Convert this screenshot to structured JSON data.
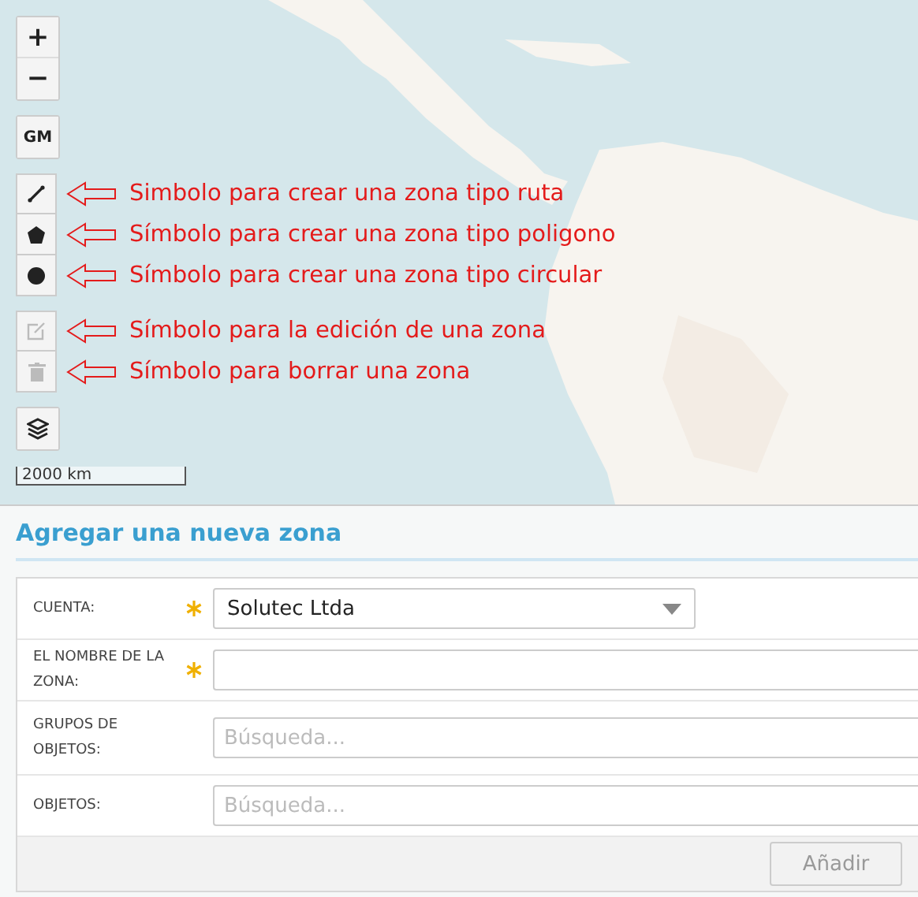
{
  "map": {
    "kind": "picture",
    "zoom_controls": [
      {
        "label": "+"
      },
      {
        "label": "−"
      }
    ],
    "gm_button": "GM",
    "draw_tools": [
      {
        "kind": "line",
        "disabled": false,
        "annotation": "Simbolo para crear una zona tipo ruta"
      },
      {
        "kind": "polygon",
        "disabled": false,
        "annotation": "Símbolo para crear una zona tipo poligono"
      },
      {
        "kind": "circle",
        "disabled": false,
        "annotation": "Símbolo para crear una zona tipo circular"
      }
    ],
    "edit_tools": [
      {
        "kind": "edit",
        "disabled": true,
        "annotation": "Símbolo para la edición de una zona"
      },
      {
        "kind": "delete",
        "disabled": true,
        "annotation": "Símbolo para borrar una zona"
      }
    ],
    "scale": "2000 km"
  },
  "panel": {
    "title": "Agregar una nueva zona",
    "fields": [
      {
        "kind": "select",
        "label": "CUENTA:",
        "required": true,
        "value": "Solutec Ltda"
      },
      {
        "kind": "text",
        "label": "EL NOMBRE DE LA ZONA:",
        "required": true
      },
      {
        "kind": "search",
        "label": "GRUPOS DE OBJETOS:",
        "required": false,
        "placeholder": "Búsqueda..."
      },
      {
        "kind": "search",
        "label": "OBJETOS:",
        "required": false,
        "placeholder": "Búsqueda..."
      }
    ],
    "button": {
      "label": "Añadir",
      "disabled": true
    }
  }
}
